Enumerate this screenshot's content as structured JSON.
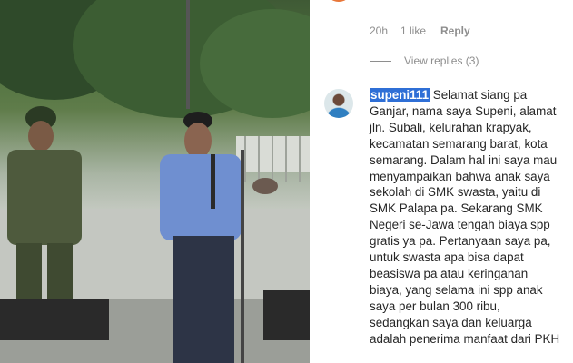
{
  "previous_comment": {
    "time": "20h",
    "likes": "1 like",
    "reply_label": "Reply",
    "view_replies": "View replies (3)"
  },
  "comment": {
    "username": "supeni111",
    "text": "Selamat siang pa Ganjar, nama saya Supeni, alamat jln. Subali, kelurahan krapyak, kecamatan semarang barat, kota semarang. Dalam hal ini saya mau menyampaikan bahwa anak saya sekolah di SMK swasta, yaitu di SMK Palapa pa. Sekarang SMK Negeri se-Jawa tengah biaya spp gratis ya pa. Pertanyaan saya pa, untuk swasta apa bisa dapat beasiswa pa atau keringanan biaya, yang selama ini spp anak saya per bulan 300 ribu, sedangkan saya dan keluarga adalah penerima manfaat dari PKH"
  },
  "colors": {
    "text": "#262626",
    "muted": "#8e8e8e",
    "selection": "#2f6fd6"
  }
}
